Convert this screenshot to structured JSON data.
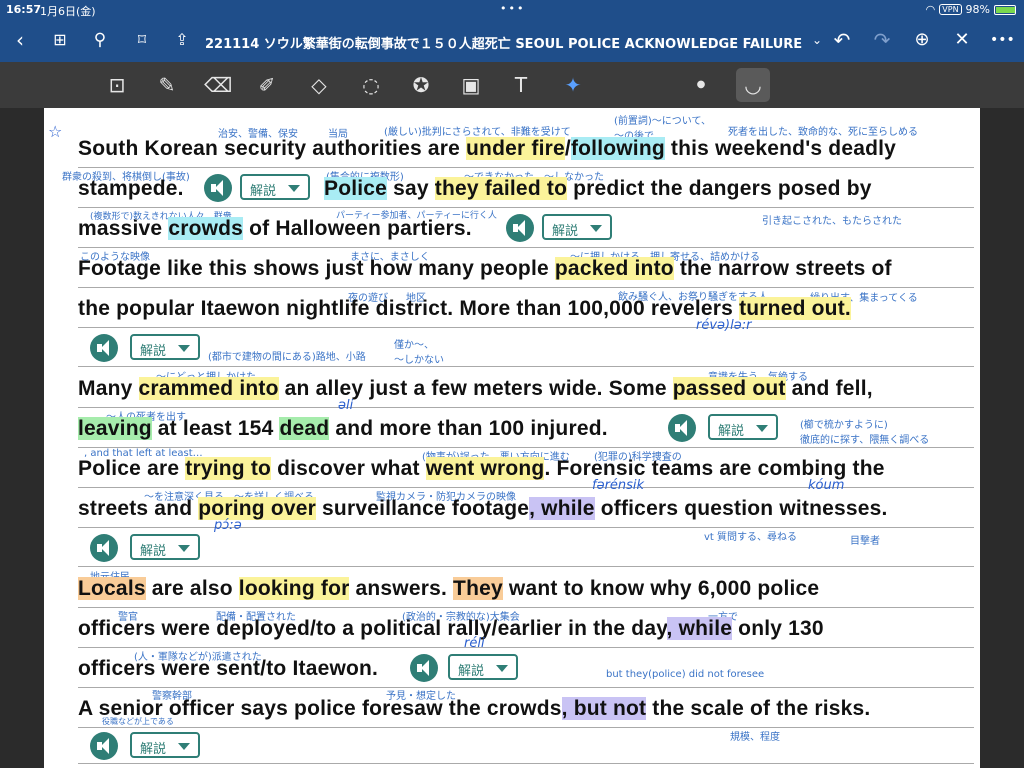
{
  "status": {
    "time": "16:57",
    "date": "1月6日(金)",
    "vpn": "VPN",
    "battery": "98%"
  },
  "nav": {
    "title": "221114 ソウル繁華街の転倒事故で１５０人超死亡 SEOUL POLICE ACKNOWLEDGE FAILURE TO PRE..."
  },
  "kaisetsu_label": "解説",
  "annotations": [
    "治安、警備、保安",
    "当局",
    "(厳しい)批判にさらされて、非難を受けて",
    "(前置詞)〜について、\n〜の後で",
    "死者を出した、致命的な、死に至らしめる",
    "群衆の殺到、将棋倒し(事故)",
    "(集合的に複数形)",
    "〜できなかった、〜しなかった",
    "(複数形で)数えきれない人々、群衆",
    "パーティー参加者、パーティーに行く人",
    "引き起こされた、もたらされた",
    "このような映像",
    "まさに、まさしく",
    "〜に押しかける、押し寄せる、詰めかける",
    "夜の遊び",
    "地区",
    "飲み騒ぐ人、お祭り騒ぎをする人",
    "繰り出す、集まってくる",
    "(都市で建物の間にある)路地、小路",
    "僅か〜、\n〜しかない",
    "〜にどっと押しかけた",
    "意識を失う、気絶する",
    "〜人の死者を出す",
    "(櫛で梳かすように)\n徹底的に探す、隈無く調べる",
    ", and that left at least…",
    "(物事が)誤った、悪い方向に進む",
    "(犯罪の)科学捜査の",
    "〜を注意深く見る、〜を詳しく調べる",
    "監視カメラ・防犯カメラの映像",
    "vt 質問する、尋ねる",
    "目撃者",
    "地元住民",
    "警官",
    "配備・配置された",
    "(政治的・宗教的な)大集会",
    "一方で",
    "(人・軍隊などが)派遣された",
    "but they(police) did not foresee",
    "警察幹部",
    "役職などが上である",
    "予見・想定した",
    "規模、程度"
  ],
  "handwriting": [
    "révə)lə:r",
    "əli",
    "fərénsik",
    "kóum",
    "pɔ́ːə",
    "réli"
  ],
  "text": {
    "l1a": "South Korean security authorities are ",
    "l1b": "under fire",
    "l1c": "/",
    "l1d": "following",
    "l1e": " this weekend's deadly",
    "l2a": "stampede.",
    "l2b": "Police",
    "l2c": " say ",
    "l2d": "they failed to",
    "l2e": " predict the dangers posed by",
    "l3a": "massive ",
    "l3b": "crowds",
    "l3c": " of Halloween partiers.",
    "l4a": "Footage like this shows just how many people ",
    "l4b": "packed into",
    "l4c": " the narrow streets of",
    "l5a": "the popular Itaewon nightlife district. More than 100,000 revelers ",
    "l5b": "turned out.",
    "l6a": "Many ",
    "l6b": "crammed into",
    "l6c": " an alley just a few meters wide. Some ",
    "l6d": "passed out",
    "l6e": " and fell,",
    "l7a": "leaving",
    "l7b": " at least 154 ",
    "l7c": "dead",
    "l7d": " and more than 100 injured.",
    "l8a": "Police are ",
    "l8b": "trying to",
    "l8c": " discover what ",
    "l8d": "went wrong",
    "l8e": ". Forensic teams are combing the",
    "l9a": "streets and ",
    "l9b": "poring over",
    "l9c": " surveillance footage",
    "l9d": ", while",
    "l9e": " officers question witnesses.",
    "l10a": "Locals",
    "l10b": " are also ",
    "l10c": "looking for",
    "l10d": " answers. ",
    "l10e": "They",
    "l10f": " want to know why 6,000 police",
    "l11a": "officers were deployed/to a political rally/earlier in the day",
    "l11b": ", while",
    "l11c": " only 130",
    "l12a": "officers were sent/to Itaewon.",
    "l13a": "A senior officer says police foresaw the crowds",
    "l13b": ", but not",
    "l13c": " the scale of the risks."
  }
}
